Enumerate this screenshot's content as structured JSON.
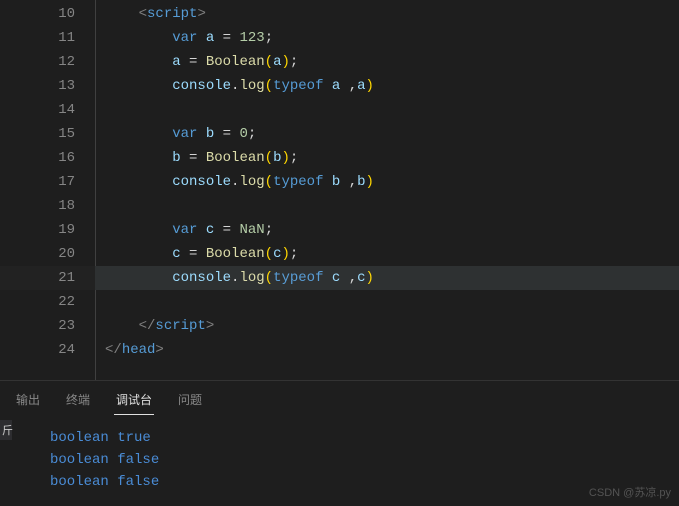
{
  "editor": {
    "lines": [
      {
        "n": "10",
        "indent": "    ",
        "tokens": [
          {
            "t": "<",
            "c": "tag"
          },
          {
            "t": "script",
            "c": "tagname"
          },
          {
            "t": ">",
            "c": "tag"
          }
        ]
      },
      {
        "n": "11",
        "indent": "        ",
        "tokens": [
          {
            "t": "var",
            "c": "kw"
          },
          {
            "t": " ",
            "c": "plain"
          },
          {
            "t": "a",
            "c": "id"
          },
          {
            "t": " = ",
            "c": "plain"
          },
          {
            "t": "123",
            "c": "num"
          },
          {
            "t": ";",
            "c": "plain"
          }
        ]
      },
      {
        "n": "12",
        "indent": "        ",
        "tokens": [
          {
            "t": "a",
            "c": "id"
          },
          {
            "t": " = ",
            "c": "plain"
          },
          {
            "t": "Boolean",
            "c": "fn"
          },
          {
            "t": "(",
            "c": "par"
          },
          {
            "t": "a",
            "c": "id"
          },
          {
            "t": ")",
            "c": "par"
          },
          {
            "t": ";",
            "c": "plain"
          }
        ]
      },
      {
        "n": "13",
        "indent": "        ",
        "tokens": [
          {
            "t": "console",
            "c": "obj"
          },
          {
            "t": ".",
            "c": "plain"
          },
          {
            "t": "log",
            "c": "fn"
          },
          {
            "t": "(",
            "c": "par"
          },
          {
            "t": "typeof",
            "c": "kw"
          },
          {
            "t": " ",
            "c": "plain"
          },
          {
            "t": "a",
            "c": "id"
          },
          {
            "t": " ,",
            "c": "plain"
          },
          {
            "t": "a",
            "c": "id"
          },
          {
            "t": ")",
            "c": "par"
          }
        ]
      },
      {
        "n": "14",
        "indent": "",
        "tokens": []
      },
      {
        "n": "15",
        "indent": "        ",
        "tokens": [
          {
            "t": "var",
            "c": "kw"
          },
          {
            "t": " ",
            "c": "plain"
          },
          {
            "t": "b",
            "c": "id"
          },
          {
            "t": " = ",
            "c": "plain"
          },
          {
            "t": "0",
            "c": "num"
          },
          {
            "t": ";",
            "c": "plain"
          }
        ]
      },
      {
        "n": "16",
        "indent": "        ",
        "tokens": [
          {
            "t": "b",
            "c": "id"
          },
          {
            "t": " = ",
            "c": "plain"
          },
          {
            "t": "Boolean",
            "c": "fn"
          },
          {
            "t": "(",
            "c": "par"
          },
          {
            "t": "b",
            "c": "id"
          },
          {
            "t": ")",
            "c": "par"
          },
          {
            "t": ";",
            "c": "plain"
          }
        ]
      },
      {
        "n": "17",
        "indent": "        ",
        "tokens": [
          {
            "t": "console",
            "c": "obj"
          },
          {
            "t": ".",
            "c": "plain"
          },
          {
            "t": "log",
            "c": "fn"
          },
          {
            "t": "(",
            "c": "par"
          },
          {
            "t": "typeof",
            "c": "kw"
          },
          {
            "t": " ",
            "c": "plain"
          },
          {
            "t": "b",
            "c": "id"
          },
          {
            "t": " ,",
            "c": "plain"
          },
          {
            "t": "b",
            "c": "id"
          },
          {
            "t": ")",
            "c": "par"
          }
        ]
      },
      {
        "n": "18",
        "indent": "",
        "tokens": []
      },
      {
        "n": "19",
        "indent": "        ",
        "tokens": [
          {
            "t": "var",
            "c": "kw"
          },
          {
            "t": " ",
            "c": "plain"
          },
          {
            "t": "c",
            "c": "id"
          },
          {
            "t": " = ",
            "c": "plain"
          },
          {
            "t": "NaN",
            "c": "num"
          },
          {
            "t": ";",
            "c": "plain"
          }
        ]
      },
      {
        "n": "20",
        "indent": "        ",
        "tokens": [
          {
            "t": "c",
            "c": "id"
          },
          {
            "t": " = ",
            "c": "plain"
          },
          {
            "t": "Boolean",
            "c": "fn"
          },
          {
            "t": "(",
            "c": "par"
          },
          {
            "t": "c",
            "c": "id"
          },
          {
            "t": ")",
            "c": "par"
          },
          {
            "t": ";",
            "c": "plain"
          }
        ]
      },
      {
        "n": "21",
        "indent": "        ",
        "hl": true,
        "tokens": [
          {
            "t": "console",
            "c": "obj"
          },
          {
            "t": ".",
            "c": "plain"
          },
          {
            "t": "log",
            "c": "fn"
          },
          {
            "t": "(",
            "c": "par"
          },
          {
            "t": "typeof",
            "c": "kw"
          },
          {
            "t": " ",
            "c": "plain"
          },
          {
            "t": "c",
            "c": "id"
          },
          {
            "t": " ,",
            "c": "plain"
          },
          {
            "t": "c",
            "c": "id"
          },
          {
            "t": ")",
            "c": "par"
          }
        ]
      },
      {
        "n": "22",
        "indent": "",
        "tokens": []
      },
      {
        "n": "23",
        "indent": "    ",
        "tokens": [
          {
            "t": "</",
            "c": "tag"
          },
          {
            "t": "script",
            "c": "tagname"
          },
          {
            "t": ">",
            "c": "tag"
          }
        ]
      },
      {
        "n": "24",
        "indent": "",
        "tokens": [
          {
            "t": "</",
            "c": "tag"
          },
          {
            "t": "head",
            "c": "tagname"
          },
          {
            "t": ">",
            "c": "tag"
          }
        ]
      }
    ]
  },
  "panel": {
    "tabs": {
      "output": "输出",
      "terminal": "终端",
      "debug": "调试台",
      "problems": "问题"
    },
    "active_tab": "debug",
    "console_output": [
      "boolean true",
      "boolean false",
      "boolean false"
    ]
  },
  "sidebar_stub": "斤",
  "watermark": "CSDN @苏凉.py"
}
